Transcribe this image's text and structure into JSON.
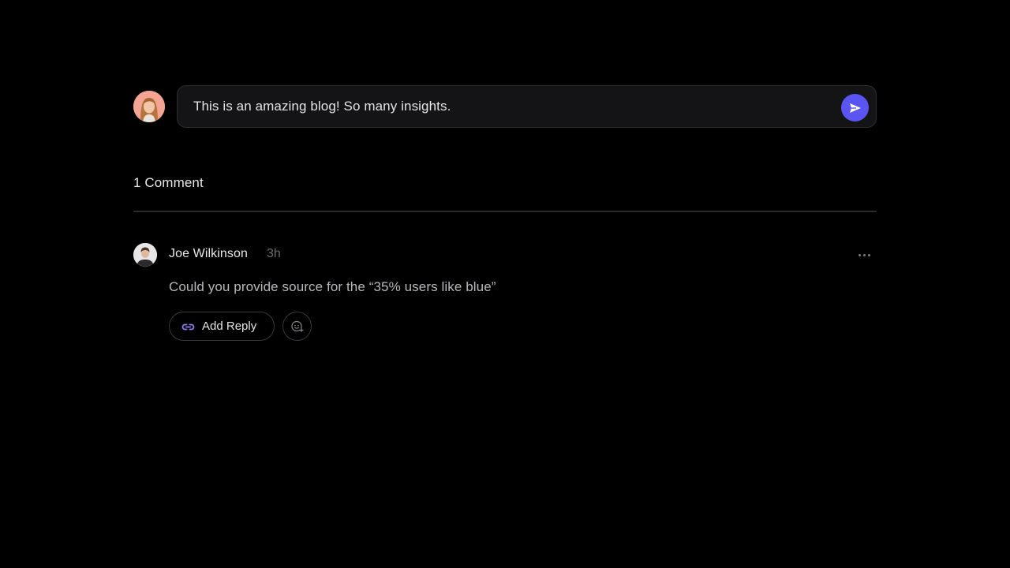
{
  "composer": {
    "avatar_icon": "user-avatar-woman",
    "input_value": "This is an amazing blog! So many insights.",
    "send_icon": "send-icon",
    "accent_color": "#5a55f2"
  },
  "comments_section": {
    "count_label": "1 Comment"
  },
  "comment": {
    "avatar_icon": "user-avatar-man",
    "author": "Joe Wilkinson",
    "time": "3h",
    "text": "Could you provide source for the “35% users like blue”",
    "more_icon": "more-horizontal-icon",
    "reply_label": "Add Reply",
    "reply_icon": "reply-link-icon",
    "emoji_icon": "add-emoji-icon"
  }
}
